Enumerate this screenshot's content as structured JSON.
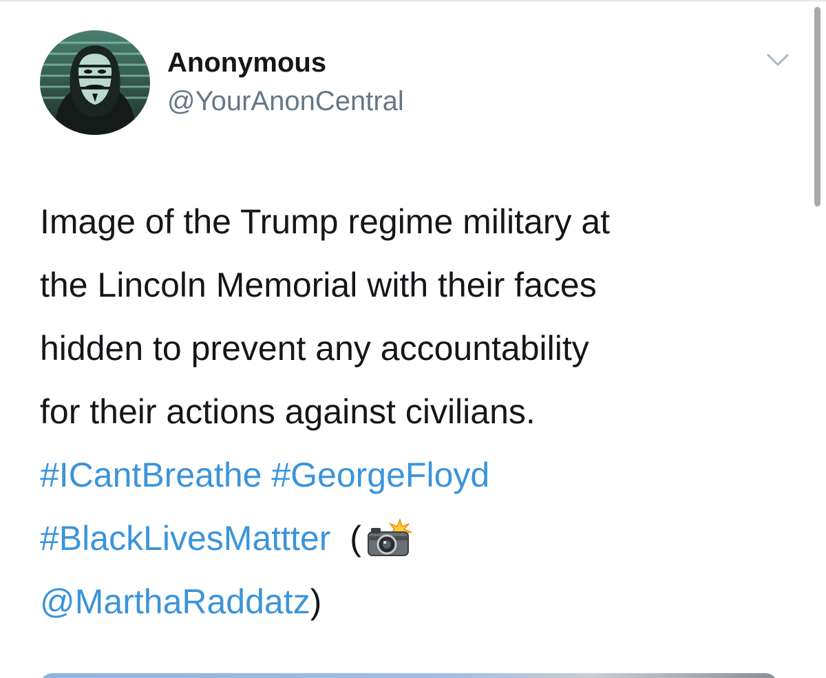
{
  "tweet": {
    "author": {
      "display_name": "Anonymous",
      "handle": "@YourAnonCentral",
      "avatar_icon": "anonymous-mask-avatar"
    },
    "menu_icon": "chevron-down-icon",
    "text_lines": [
      "Image of the Trump regime military at",
      "the Lincoln Memorial with their faces",
      "hidden to prevent any accountability",
      "for their actions against civilians."
    ],
    "hashtags": {
      "icantbreathe": "#ICantBreathe",
      "georgefloyd": "#GeorgeFloyd",
      "blacklivesmatter": "#BlackLivesMattter"
    },
    "credit": {
      "open_paren": "(",
      "camera_emoji": "camera-with-flash-icon",
      "mention": "@MarthaRaddatz",
      "close_paren": ")"
    }
  },
  "colors": {
    "text": "#14171a",
    "secondary": "#657786",
    "link": "#3b94d9"
  }
}
